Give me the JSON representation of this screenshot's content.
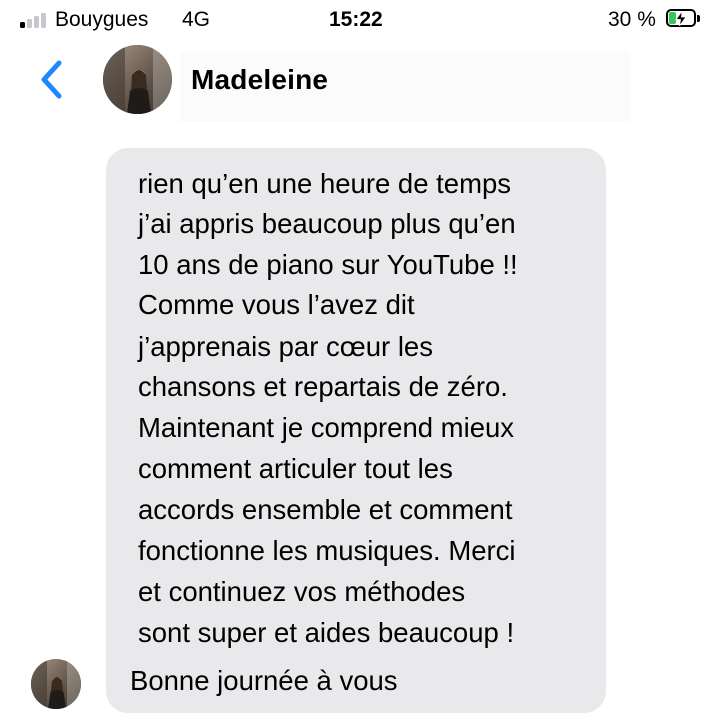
{
  "status_bar": {
    "carrier": "Bouygues",
    "network": "4G",
    "time": "15:22",
    "battery_percent": "30 %",
    "battery_level": 0.3,
    "battery_charging": true,
    "signal_bars_active": 1,
    "signal_bars_total": 4
  },
  "header": {
    "back_icon": "chevron-left-icon",
    "contact_name": "Madeleine",
    "accent_color": "#1e88ff"
  },
  "conversation": {
    "message": {
      "bubble_color": "#e9e9eb",
      "lines": [
        "rien qu’en une heure de temps",
        "j’ai appris beaucoup plus qu’en",
        "10 ans de piano sur YouTube !!",
        "Comme vous l’avez dit",
        "j’apprenais par cœur les",
        "chansons et repartais de zéro.",
        "Maintenant je comprend mieux",
        "comment articuler tout les",
        "accords ensemble et comment",
        "fonctionne les musiques. Merci",
        "et continuez vos méthodes",
        "sont super et aides beaucoup !",
        "Bonne journée à vous"
      ]
    }
  }
}
